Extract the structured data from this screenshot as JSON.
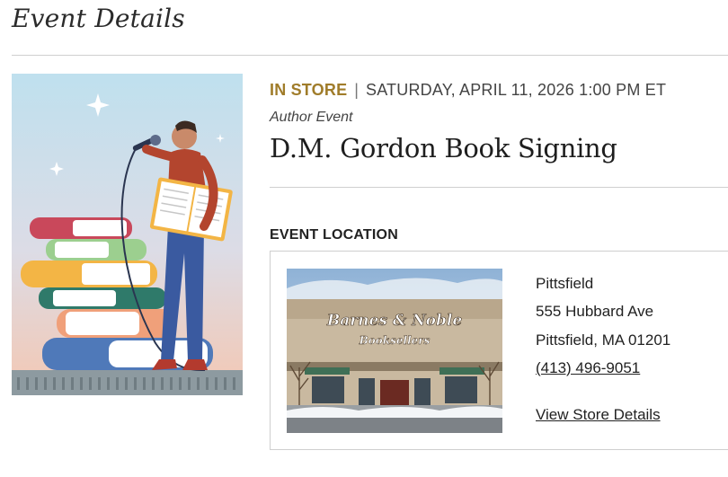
{
  "page": {
    "heading": "Event Details"
  },
  "event": {
    "badge": "IN STORE",
    "separator": "|",
    "datetime": "SATURDAY, APRIL 11, 2026 1:00 PM ET",
    "type": "Author Event",
    "title": "D.M. Gordon Book Signing",
    "colors": {
      "badge": "#a07c2a"
    }
  },
  "location": {
    "heading": "EVENT LOCATION",
    "store_sign_line1": "Barnes & Noble",
    "store_sign_line2": "Booksellers",
    "city_name": "Pittsfield",
    "street": "555 Hubbard Ave",
    "city_state_zip": "Pittsfield, MA 01201",
    "phone": "(413) 496-9051",
    "details_link": "View Store Details"
  }
}
